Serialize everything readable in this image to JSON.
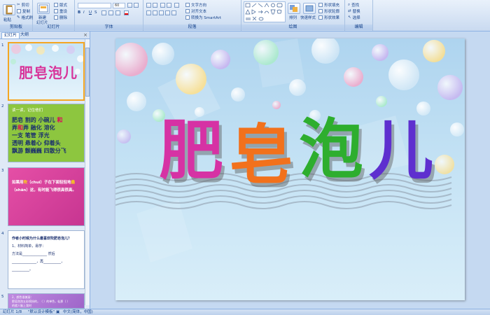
{
  "ribbon": {
    "groups": {
      "clipboard": "剪贴板",
      "slides": "幻灯片",
      "font": "字体",
      "paragraph": "段落",
      "drawing": "绘图",
      "editing": "编辑"
    },
    "clipboard": {
      "paste": "粘贴",
      "cut": "剪切",
      "copy": "复制",
      "format_painter": "格式刷"
    },
    "slides": {
      "new_slide": "新建",
      "new_slide2": "幻灯片",
      "layout": "版式",
      "reset": "重设",
      "delete": "删除"
    },
    "font": {
      "font_size": "60"
    },
    "paragraph": {
      "text_direction": "文字方向",
      "align_text": "对齐文本",
      "smartart": "转换为 SmartArt"
    },
    "drawing": {
      "arrange": "排列",
      "quick_styles": "快速样式",
      "shape_fill": "形状填充",
      "shape_outline": "形状轮廓",
      "shape_effects": "形状效果"
    },
    "editing": {
      "find": "查找",
      "replace": "替换",
      "select": "选择"
    }
  },
  "left_pane": {
    "tab_slides": "幻灯片",
    "tab_outline": "大纲",
    "close": "×",
    "slides": [
      {
        "num": "1",
        "title": "肥皂泡儿"
      },
      {
        "num": "2",
        "heading": "读一读，记住他们",
        "lines": [
          [
            "肥皂",
            "割的",
            "小碗儿",
            "和"
          ],
          [
            "弄",
            "和",
            "弄",
            "融化",
            "溶化"
          ],
          [
            "一支",
            "笔管",
            "浮光"
          ],
          [
            "透明",
            "悬着心",
            "仰着头"
          ],
          [
            "飘游",
            "颤巍巍",
            "四散分飞"
          ]
        ]
      },
      {
        "num": "3",
        "text1": "如果用",
        "hl1": "吹",
        "text2": "（chuī）子在下面轻轻地",
        "hl2": "扇",
        "text3": "（shān）这，有时能飞得很高很",
        "text4": "高。"
      },
      {
        "num": "4",
        "q": "作者小时候为什么最喜欢吹肥皂泡儿？",
        "l1": "1、材料简单，易学：",
        "l2": "方法是______________ 然后",
        "l3": "______________，再__________，",
        "l4": "__________。"
      },
      {
        "num": "5",
        "l1": "2、颜色很美丽：",
        "l2": "肥皂泡泡五彩缤纷的，（       ）的单色，仙那（       ）",
        "l3": "的就人脑上我时"
      }
    ]
  },
  "slide_main": {
    "title_chars": [
      "肥",
      "皂",
      "泡",
      "儿"
    ]
  },
  "status": {
    "slide_info": "幻灯片 1/8",
    "theme": "\"默认设计模板\"",
    "language": "中文(简体，中国)"
  },
  "colors": {
    "accent": "#f5a623",
    "ribbon_text": "#15428b"
  }
}
